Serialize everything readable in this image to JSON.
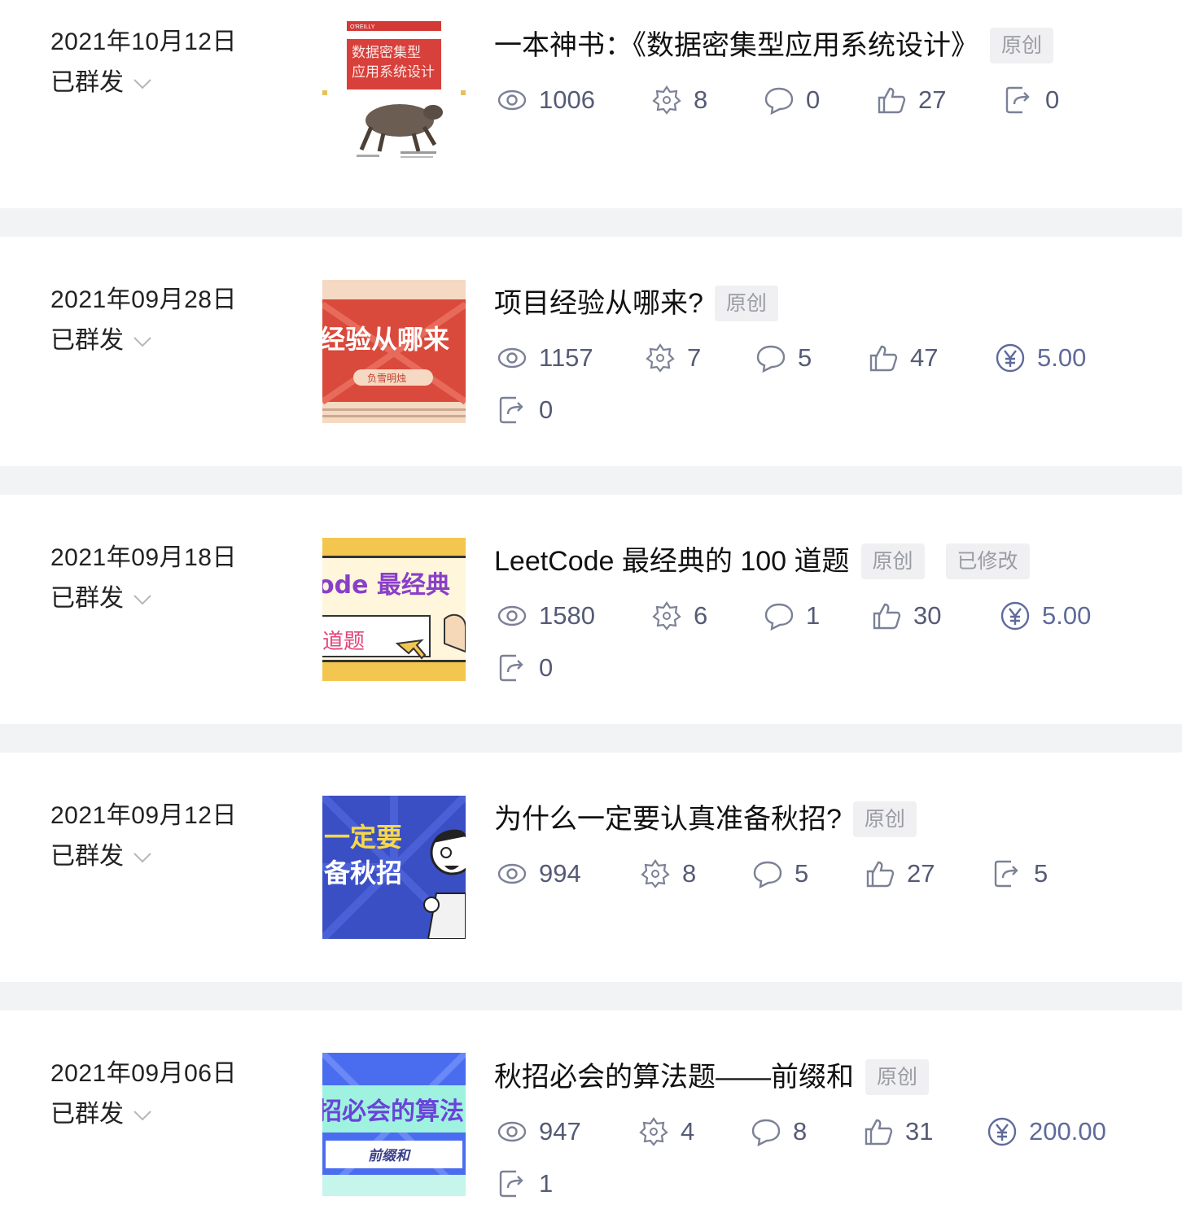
{
  "articles": [
    {
      "date": "2021年10月12日",
      "status": "已群发",
      "thumb_text": [
        "数据密集型",
        "应用系统设计"
      ],
      "thumb_brand": "O'REILLY",
      "title": "一本神书：《数据密集型应用系统设计》",
      "tags": [
        "原创"
      ],
      "views": "1006",
      "watch": "8",
      "comments": "0",
      "likes": "27",
      "shares": "0"
    },
    {
      "date": "2021年09月28日",
      "status": "已群发",
      "thumb_text": [
        "经验从哪来",
        "负雪明烛"
      ],
      "title": "项目经验从哪来?",
      "tags": [
        "原创"
      ],
      "views": "1157",
      "watch": "7",
      "comments": "5",
      "likes": "47",
      "reward": "5.00",
      "shares": "0"
    },
    {
      "date": "2021年09月18日",
      "status": "已群发",
      "thumb_text": [
        "ode 最经典",
        "道题"
      ],
      "title": "LeetCode 最经典的 100 道题",
      "tags": [
        "原创",
        "已修改"
      ],
      "views": "1580",
      "watch": "6",
      "comments": "1",
      "likes": "30",
      "reward": "5.00",
      "shares": "0"
    },
    {
      "date": "2021年09月12日",
      "status": "已群发",
      "thumb_text": [
        "一定要",
        "备秋招"
      ],
      "title": "为什么一定要认真准备秋招?",
      "tags": [
        "原创"
      ],
      "views": "994",
      "watch": "8",
      "comments": "5",
      "likes": "27",
      "shares": "5"
    },
    {
      "date": "2021年09月06日",
      "status": "已群发",
      "thumb_text": [
        "招必会的算法",
        "前缀和"
      ],
      "title": "秋招必会的算法题——前缀和",
      "tags": [
        "原创"
      ],
      "views": "947",
      "watch": "4",
      "comments": "8",
      "likes": "31",
      "reward": "200.00",
      "shares": "1"
    }
  ],
  "colors": {
    "icon": "#7b8196",
    "tag_bg": "#f0f0f2",
    "tag_text": "#9a9ca3",
    "reward": "#5f6a9a"
  },
  "icons": {
    "status": "chevron-down-icon",
    "views": "eye-icon",
    "watch": "watch-icon",
    "comments": "comment-icon",
    "likes": "thumbs-up-icon",
    "reward": "yuan-icon",
    "shares": "share-icon"
  }
}
